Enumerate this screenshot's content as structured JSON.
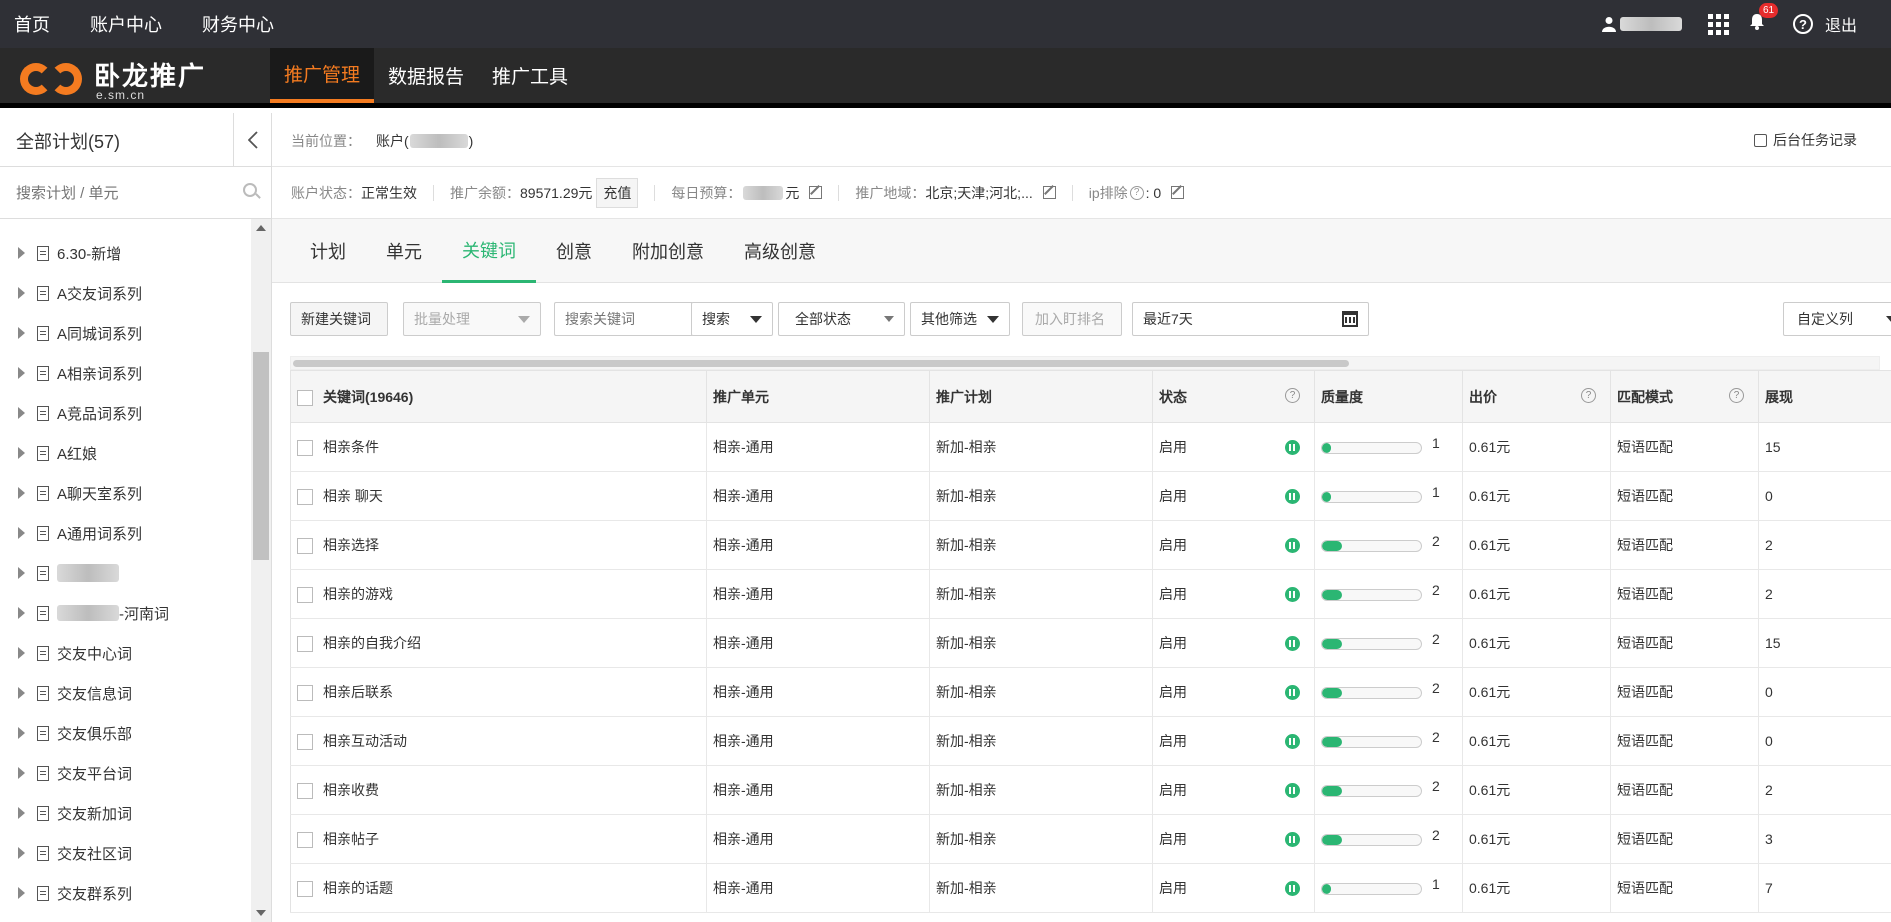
{
  "topnav": {
    "items": [
      "首页",
      "账户中心",
      "财务中心"
    ],
    "notification_count": "61",
    "logout": "退出"
  },
  "brand": {
    "name": "卧龙推广",
    "domain": "e.sm.cn",
    "nav": [
      "推广管理",
      "数据报告",
      "推广工具"
    ],
    "active_nav": "推广管理"
  },
  "sidebar": {
    "title": "全部计划(57)",
    "search_placeholder": "搜索计划 / 单元",
    "plans": [
      "6.30-新增",
      "A交友词系列",
      "A同城词系列",
      "A相亲词系列",
      "A竞品词系列",
      "A红娘",
      "A聊天室系列",
      "A通用词系列",
      "",
      "-河南词",
      "交友中心词",
      "交友信息词",
      "交友俱乐部",
      "交友平台词",
      "交友新加词",
      "交友社区词",
      "交友群系列"
    ]
  },
  "breadcrumb": {
    "label": "当前位置：",
    "account_prefix": "账户(",
    "account_suffix": ")",
    "task_record": "后台任务记录"
  },
  "account_status": {
    "status_label": "账户状态：",
    "status_value": "正常生效",
    "balance_label": "推广余额：",
    "balance_value": "89571.29元",
    "recharge": "充值",
    "budget_label": "每日预算：",
    "budget_unit": "元",
    "region_label": "推广地域：",
    "region_value": "北京;天津;河北;...",
    "ip_label": "ip排除",
    "ip_value": ": 0"
  },
  "tabs": [
    "计划",
    "单元",
    "关键词",
    "创意",
    "附加创意",
    "高级创意"
  ],
  "active_tab": "关键词",
  "toolbar": {
    "new_keyword": "新建关键词",
    "batch": "批量处理",
    "search_placeholder": "搜索关键词",
    "search": "搜索",
    "all_status": "全部状态",
    "other_filter": "其他筛选",
    "add_rank": "加入盯排名",
    "date_range": "最近7天",
    "custom_columns": "自定义列"
  },
  "table": {
    "columns": [
      "关键词(19646)",
      "推广单元",
      "推广计划",
      "状态",
      "质量度",
      "出价",
      "匹配模式",
      "展现"
    ],
    "rows": [
      {
        "keyword": "相亲条件",
        "unit": "相亲-通用",
        "plan": "新加-相亲",
        "status": "启用",
        "quality": 1,
        "bid": "0.61元",
        "match": "短语匹配",
        "impressions": "15"
      },
      {
        "keyword": "相亲 聊天",
        "unit": "相亲-通用",
        "plan": "新加-相亲",
        "status": "启用",
        "quality": 1,
        "bid": "0.61元",
        "match": "短语匹配",
        "impressions": "0"
      },
      {
        "keyword": "相亲选择",
        "unit": "相亲-通用",
        "plan": "新加-相亲",
        "status": "启用",
        "quality": 2,
        "bid": "0.61元",
        "match": "短语匹配",
        "impressions": "2"
      },
      {
        "keyword": "相亲的游戏",
        "unit": "相亲-通用",
        "plan": "新加-相亲",
        "status": "启用",
        "quality": 2,
        "bid": "0.61元",
        "match": "短语匹配",
        "impressions": "2"
      },
      {
        "keyword": "相亲的自我介绍",
        "unit": "相亲-通用",
        "plan": "新加-相亲",
        "status": "启用",
        "quality": 2,
        "bid": "0.61元",
        "match": "短语匹配",
        "impressions": "15"
      },
      {
        "keyword": "相亲后联系",
        "unit": "相亲-通用",
        "plan": "新加-相亲",
        "status": "启用",
        "quality": 2,
        "bid": "0.61元",
        "match": "短语匹配",
        "impressions": "0"
      },
      {
        "keyword": "相亲互动活动",
        "unit": "相亲-通用",
        "plan": "新加-相亲",
        "status": "启用",
        "quality": 2,
        "bid": "0.61元",
        "match": "短语匹配",
        "impressions": "0"
      },
      {
        "keyword": "相亲收费",
        "unit": "相亲-通用",
        "plan": "新加-相亲",
        "status": "启用",
        "quality": 2,
        "bid": "0.61元",
        "match": "短语匹配",
        "impressions": "2"
      },
      {
        "keyword": "相亲帖子",
        "unit": "相亲-通用",
        "plan": "新加-相亲",
        "status": "启用",
        "quality": 2,
        "bid": "0.61元",
        "match": "短语匹配",
        "impressions": "3"
      },
      {
        "keyword": "相亲的话题",
        "unit": "相亲-通用",
        "plan": "新加-相亲",
        "status": "启用",
        "quality": 1,
        "bid": "0.61元",
        "match": "短语匹配",
        "impressions": "7"
      }
    ]
  },
  "colors": {
    "accent_green": "#2bb673",
    "brand_orange": "#f47b20",
    "topbar": "#2f3036"
  }
}
